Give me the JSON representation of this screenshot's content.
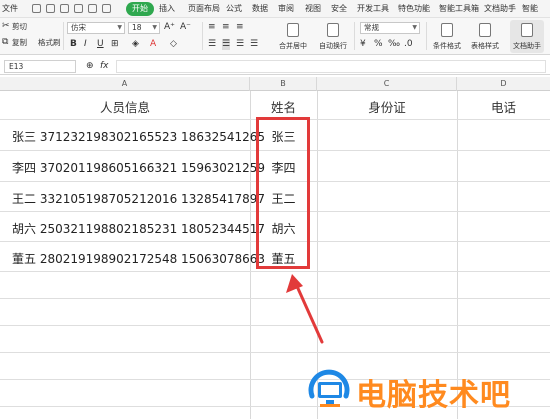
{
  "menubar": {
    "file_label": "文件",
    "tabs": [
      {
        "label": "开始",
        "active": true
      },
      {
        "label": "插入",
        "active": false
      },
      {
        "label": "页面布局",
        "active": false
      },
      {
        "label": "公式",
        "active": false
      },
      {
        "label": "数据",
        "active": false
      },
      {
        "label": "审阅",
        "active": false
      },
      {
        "label": "视图",
        "active": false
      },
      {
        "label": "安全",
        "active": false
      },
      {
        "label": "开发工具",
        "active": false
      },
      {
        "label": "特色功能",
        "active": false
      },
      {
        "label": "智能工具箱",
        "active": false
      },
      {
        "label": "文档助手",
        "active": false
      },
      {
        "label": "智能",
        "active": false
      }
    ],
    "accent_color": "#2fa84f"
  },
  "toolbar": {
    "cut_label": "剪切",
    "paste_label": "粘贴",
    "copy_label": "复制",
    "format_painter_label": "格式刷",
    "font_name": "仿宋",
    "font_size": "18",
    "number_format": "常规",
    "merge_label": "合并居中",
    "wrap_label": "自动换行",
    "conditional_format_label": "条件格式",
    "table_style_label": "表格样式",
    "doc_assistant_label": "文档助手"
  },
  "formula_bar": {
    "cell_ref": "E13",
    "fx_label": "fx",
    "value": ""
  },
  "columns": [
    "A",
    "B",
    "C",
    "D"
  ],
  "sheet": {
    "headers": {
      "a": "人员信息",
      "b": "姓名",
      "c": "身份证",
      "d": "电话"
    },
    "rows": [
      {
        "a": "张三  371232198302165523  18632541265",
        "b": "张三"
      },
      {
        "a": "李四  370201198605166321  15963021259",
        "b": "李四"
      },
      {
        "a": "王二  332105198705212016  13285417897",
        "b": "王二"
      },
      {
        "a": "胡六  250321198802185231  18052344517",
        "b": "胡六"
      },
      {
        "a": "董五  280219198902172548  15063078663",
        "b": "董五"
      }
    ]
  },
  "annotation": {
    "highlight_color": "#e23a3a"
  },
  "watermark": {
    "text": "电脑技术吧",
    "color": "#ff8a1f"
  }
}
